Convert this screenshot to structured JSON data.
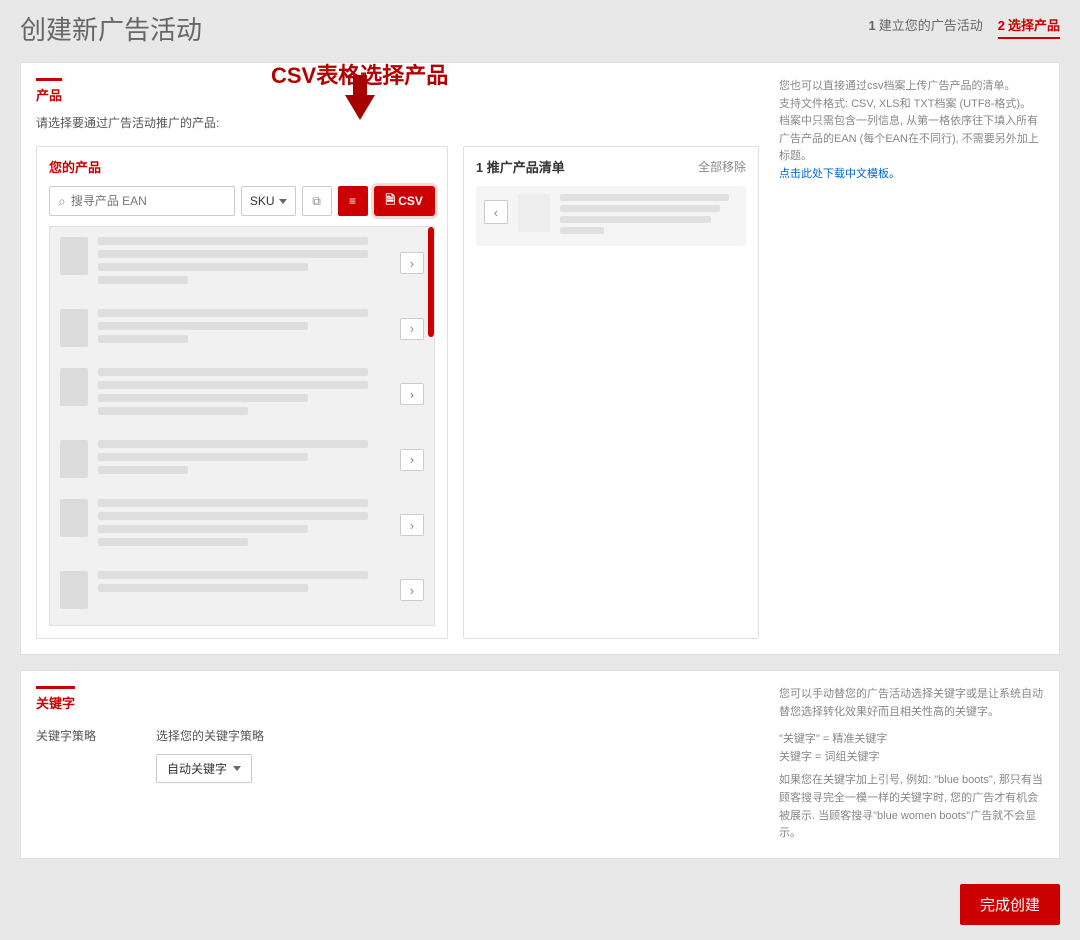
{
  "page": {
    "title": "创建新广告活动"
  },
  "steps": {
    "s1": {
      "num": "1",
      "label": "建立您的广告活动"
    },
    "s2": {
      "num": "2",
      "label": "选择产品"
    }
  },
  "products_card": {
    "tag": "产品",
    "sub_label": "请选择要通过广告活动推广的产品:",
    "help_line1": "您也可以直接通过csv档案上传广告产品的清单。",
    "help_line2": "支持文件格式: CSV, XLS和 TXT档案 (UTF8-格式)。",
    "help_line3": "档案中只需包含一列信息, 从第一格依序往下填入所有广告产品的EAN (每个EAN在不同行), 不需要另外加上标题。",
    "help_link": "点击此处下载中文模板。",
    "annotation": "CSV表格选择产品",
    "left_title": "您的产品",
    "search_placeholder": "搜寻产品 EAN",
    "sku_label": "SKU",
    "csv_label": "CSV",
    "right_title": "1 推广产品清单",
    "clear_all": "全部移除"
  },
  "keywords_card": {
    "tag": "关键字",
    "strategy_label": "关键字策略",
    "select_label": "选择您的关键字策略",
    "auto_option": "自动关键字",
    "help_line1": "您可以手动替您的广告活动选择关键字或是让系统自动替您选择转化效果好而且相关性高的关键字。",
    "help_line2": "\"关键字\" = 精准关键字",
    "help_line3": "关键字 = 词组关键字",
    "help_line4": "如果您在关键字加上引号, 例如: \"blue boots\", 那只有当顾客搜寻完全一模一样的关键字时, 您的广告才有机会被展示. 当顾客搜寻\"blue women boots\"广告就不会显示。"
  },
  "footer": {
    "finish": "完成创建"
  }
}
